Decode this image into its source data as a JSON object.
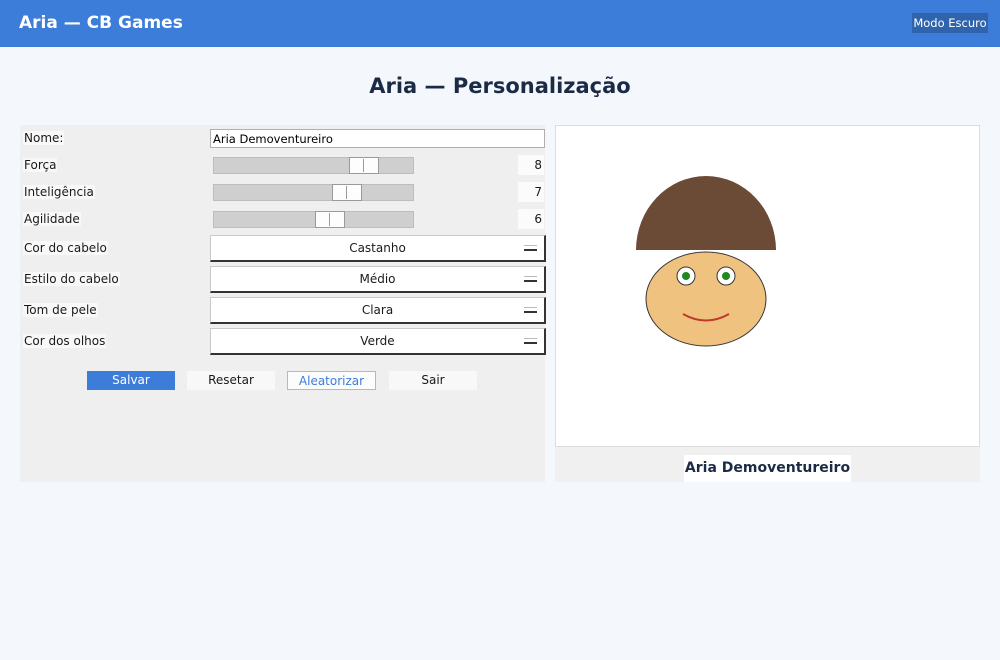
{
  "header": {
    "title": "Aria — CB Games",
    "dark_mode_label": "Modo Escuro"
  },
  "page": {
    "title": "Aria — Personalização"
  },
  "form": {
    "name": {
      "label": "Nome:",
      "value": "Aria Demoventureiro"
    },
    "sliders": [
      {
        "label": "Força",
        "value": 8,
        "max": 10
      },
      {
        "label": "Inteligência",
        "value": 7,
        "max": 10
      },
      {
        "label": "Agilidade",
        "value": 6,
        "max": 10
      }
    ],
    "selects": [
      {
        "label": "Cor do cabelo",
        "value": "Castanho"
      },
      {
        "label": "Estilo do cabelo",
        "value": "Médio"
      },
      {
        "label": "Tom de pele",
        "value": "Clara"
      },
      {
        "label": "Cor dos olhos",
        "value": "Verde"
      }
    ]
  },
  "buttons": {
    "save": "Salvar",
    "reset": "Resetar",
    "randomize": "Aleatorizar",
    "exit": "Sair"
  },
  "preview": {
    "name": "Aria Demoventureiro",
    "colors": {
      "hair": "#6b4a36",
      "skin": "#f0c27f",
      "eyes": "#1f8a1f",
      "mouth": "#c0392b",
      "outline": "#333333"
    }
  },
  "colors": {
    "accent": "#3b7dd8",
    "background": "#f4f8fd",
    "panel": "#efefef"
  }
}
